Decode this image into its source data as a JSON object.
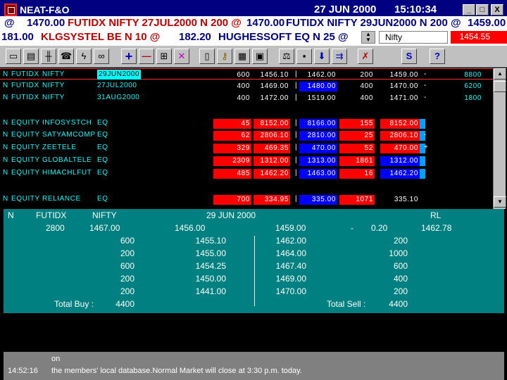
{
  "window": {
    "title": "NEAT-F&O",
    "date": "27 JUN 2000",
    "time": "15:10:34",
    "buttons": [
      "_",
      "□",
      "X"
    ]
  },
  "ticker1": {
    "left": "@",
    "item1_price": "1470.00",
    "item1_desc": "FUTIDX NIFTY 27JUL2000 N 200 @",
    "item2_price": "1470.00",
    "item2_desc": "FUTIDX NIFTY 29JUN2000 N 200 @",
    "item3_price": "1459.00"
  },
  "ticker2": {
    "item1_price": "181.00",
    "item1_desc": "KLGSYSTEL BE N 10 @",
    "item2_price": "182.20",
    "item2_desc": "HUGHESSOFT EQ N 25 @",
    "index_name": "Nifty",
    "index_value": "1454.55"
  },
  "toolbar": {
    "icons": [
      "window-icon",
      "portfolio-icon",
      "chart-icon",
      "phone-icon",
      "lightning-icon",
      "binoculars-icon",
      "plus-icon",
      "minus-icon",
      "modify-icon",
      "cancel-icon",
      "book-icon",
      "key-icon",
      "orders-icon",
      "trades-icon",
      "scale-icon",
      "save-icon",
      "download-icon",
      "transfer-icon",
      "exit-icon",
      "s-icon",
      "help-icon"
    ],
    "labels": {
      "plus": "+",
      "minus": "—",
      "s": "S",
      "help": "?"
    }
  },
  "market_watch": [
    {
      "type": "N",
      "instr": "FUTIDX",
      "symbol": "NIFTY",
      "series": "29JUN2000",
      "bqty": "600",
      "bprice": "1456.10",
      "sep": "|",
      "sprice": "1462.00",
      "sqty": "200",
      "ltp": "1459.00",
      "chg": "-",
      "vol": "8800",
      "selected": true
    },
    {
      "type": "N",
      "instr": "FUTIDX",
      "symbol": "NIFTY",
      "series": "27JUL2000",
      "bqty": "400",
      "bprice": "1469.00",
      "sep": "|",
      "sprice": "1480.00",
      "sqty": "400",
      "ltp": "1470.00",
      "chg": "-",
      "vol": "6200"
    },
    {
      "type": "N",
      "instr": "FUTIDX",
      "symbol": "NIFTY",
      "series": "31AUG2000",
      "bqty": "400",
      "bprice": "1472.00",
      "sep": "|",
      "sprice": "1519.00",
      "sqty": "400",
      "ltp": "1471.00",
      "chg": "-",
      "vol": "1800"
    },
    {
      "type": "N",
      "instr": "EQUITY",
      "symbol": "INFOSYSTCH",
      "series": "EQ",
      "bqty": "45",
      "bprice": "8152.00",
      "sep": "|",
      "sprice": "8166.00",
      "sqty": "155",
      "ltp": "8152.00",
      "chg": "",
      "vol": ""
    },
    {
      "type": "N",
      "instr": "EQUITY",
      "symbol": "SATYAMCOMP",
      "series": "EQ",
      "bqty": "62",
      "bprice": "2806.10",
      "sep": "|",
      "sprice": "2810.00",
      "sqty": "25",
      "ltp": "2806.10",
      "chg": "-",
      "vol": ""
    },
    {
      "type": "N",
      "instr": "EQUITY",
      "symbol": "ZEETELE",
      "series": "EQ",
      "bqty": "329",
      "bprice": "469.35",
      "sep": "|",
      "sprice": "470.00",
      "sqty": "52",
      "ltp": "470.00",
      "chg": "+",
      "vol": ""
    },
    {
      "type": "N",
      "instr": "EQUITY",
      "symbol": "GLOBALTELE",
      "series": "EQ",
      "bqty": "2309",
      "bprice": "1312.00",
      "sep": "|",
      "sprice": "1313.00",
      "sqty": "1861",
      "ltp": "1312.00",
      "chg": "",
      "vol": ""
    },
    {
      "type": "N",
      "instr": "EQUITY",
      "symbol": "HIMACHLFUT",
      "series": "EQ",
      "bqty": "485",
      "bprice": "1462.20",
      "sep": "|",
      "sprice": "1463.00",
      "sqty": "16",
      "ltp": "1462.20",
      "chg": "",
      "vol": ""
    },
    {
      "type": "N",
      "instr": "EQUITY",
      "symbol": "RELIANCE",
      "series": "EQ",
      "bqty": "700",
      "bprice": "334.95",
      "sep": "|",
      "sprice": "335.00",
      "sqty": "1071",
      "ltp": "335.10",
      "chg": "",
      "vol": ""
    }
  ],
  "market_depth": {
    "header": {
      "type": "N",
      "instr": "FUTIDX",
      "symbol": "NIFTY",
      "expiry": "29 JUN 2000",
      "flag": "RL"
    },
    "summary": {
      "qty": "2800",
      "open": "1467.00",
      "low": "1456.00",
      "close": "1459.00",
      "dash": "-",
      "chg": "0.20",
      "atp": "1462.78"
    },
    "bids": [
      {
        "qty": "600",
        "price": "1455.10"
      },
      {
        "qty": "200",
        "price": "1455.00"
      },
      {
        "qty": "600",
        "price": "1454.25"
      },
      {
        "qty": "200",
        "price": "1450.00"
      },
      {
        "qty": "200",
        "price": "1441.00"
      }
    ],
    "asks": [
      {
        "price": "1462.00",
        "qty": "200"
      },
      {
        "price": "1464.00",
        "qty": "1000"
      },
      {
        "price": "1467.40",
        "qty": "600"
      },
      {
        "price": "1469.00",
        "qty": "400"
      },
      {
        "price": "1470.00",
        "qty": "200"
      }
    ],
    "total_buy_label": "Total Buy :",
    "total_buy": "4400",
    "total_sell_label": "Total Sell :",
    "total_sell": "4400"
  },
  "messages": {
    "line1": "on",
    "time": "14:52:16",
    "line2": "the members' local database.Normal Market will close at 3:30 p.m. today."
  }
}
